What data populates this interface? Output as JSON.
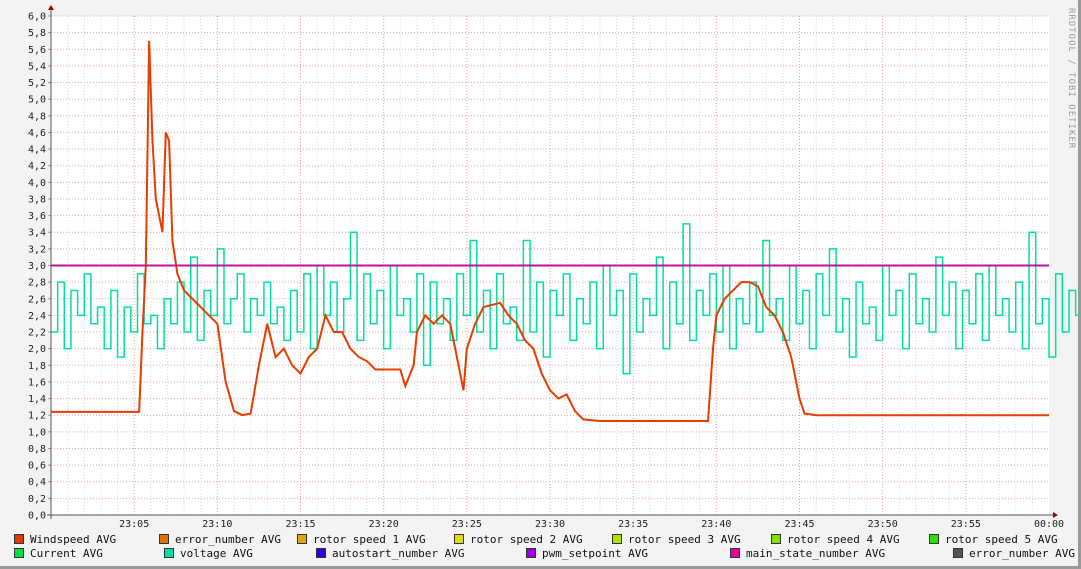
{
  "chart_data": {
    "type": "line",
    "watermark": "RRDTOOL / TOBI OETIKER",
    "ylim": [
      0,
      6
    ],
    "yticks": [
      "0,0",
      "0,2",
      "0,4",
      "0,6",
      "0,8",
      "1,0",
      "1,2",
      "1,4",
      "1,6",
      "1,8",
      "2,0",
      "2,2",
      "2,4",
      "2,6",
      "2,8",
      "3,0",
      "3,2",
      "3,4",
      "3,6",
      "3,8",
      "4,0",
      "4,2",
      "4,4",
      "4,6",
      "4,8",
      "5,0",
      "5,2",
      "5,4",
      "5,6",
      "5,8",
      "6,0"
    ],
    "xlim_minutes": [
      0,
      60
    ],
    "xticks": [
      {
        "m": 5,
        "label": "23:05"
      },
      {
        "m": 10,
        "label": "23:10"
      },
      {
        "m": 15,
        "label": "23:15"
      },
      {
        "m": 20,
        "label": "23:20"
      },
      {
        "m": 25,
        "label": "23:25"
      },
      {
        "m": 30,
        "label": "23:30"
      },
      {
        "m": 35,
        "label": "23:35"
      },
      {
        "m": 40,
        "label": "23:40"
      },
      {
        "m": 45,
        "label": "23:45"
      },
      {
        "m": 50,
        "label": "23:50"
      },
      {
        "m": 55,
        "label": "23:55"
      },
      {
        "m": 60,
        "label": "00:00"
      }
    ],
    "series": [
      {
        "name": "voltage AVG",
        "color": "#00e0a0",
        "step_minutes": 0.4,
        "values": [
          2.2,
          2.8,
          2.0,
          2.7,
          2.4,
          2.9,
          2.3,
          2.5,
          2.0,
          2.7,
          1.9,
          2.5,
          2.2,
          2.9,
          2.3,
          2.4,
          2.0,
          2.6,
          2.3,
          2.8,
          2.2,
          3.1,
          2.1,
          2.7,
          2.4,
          3.2,
          2.3,
          2.6,
          2.9,
          2.2,
          2.6,
          2.4,
          2.8,
          2.3,
          2.5,
          2.1,
          2.7,
          2.2,
          2.9,
          2.0,
          3.0,
          2.4,
          2.8,
          2.2,
          2.6,
          3.4,
          2.1,
          2.9,
          2.3,
          2.7,
          2.0,
          3.0,
          2.4,
          2.6,
          2.2,
          2.9,
          1.8,
          2.8,
          2.3,
          2.6,
          2.1,
          2.9,
          2.4,
          3.3,
          2.2,
          2.7,
          2.0,
          2.9,
          2.3,
          2.5,
          2.1,
          3.3,
          2.2,
          2.8,
          1.9,
          2.7,
          2.4,
          2.9,
          2.1,
          2.6,
          2.3,
          2.8,
          2.0,
          3.0,
          2.4,
          2.7,
          1.7,
          2.9,
          2.2,
          2.6,
          2.4,
          3.1,
          2.0,
          2.8,
          2.3,
          3.5,
          2.1,
          2.7,
          2.4,
          2.9,
          2.2,
          3.0,
          2.0,
          2.6,
          2.3,
          2.8,
          2.2,
          3.3,
          2.4,
          2.6,
          2.1,
          3.0,
          2.3,
          2.7,
          2.0,
          2.9,
          2.4,
          3.2,
          2.2,
          2.6,
          1.9,
          2.8,
          2.3,
          2.5,
          2.1,
          3.0,
          2.4,
          2.7,
          2.0,
          2.9,
          2.3,
          2.6,
          2.2,
          3.1,
          2.4,
          2.8,
          2.0,
          2.7,
          2.3,
          2.9,
          2.1,
          3.0,
          2.4,
          2.6,
          2.2,
          2.8,
          2.0,
          3.4,
          2.3,
          2.6,
          1.9,
          2.9,
          2.2,
          2.7,
          2.4,
          3.0,
          2.1
        ]
      },
      {
        "name": "Windspeed AVG",
        "color": "#e83c00",
        "points": [
          [
            0,
            1.24
          ],
          [
            5.3,
            1.24
          ],
          [
            5.5,
            2.2
          ],
          [
            5.7,
            3.0
          ],
          [
            5.9,
            5.7
          ],
          [
            6.1,
            4.5
          ],
          [
            6.3,
            3.8
          ],
          [
            6.7,
            3.4
          ],
          [
            6.9,
            4.6
          ],
          [
            7.1,
            4.5
          ],
          [
            7.3,
            3.3
          ],
          [
            7.6,
            2.9
          ],
          [
            8,
            2.7
          ],
          [
            8.5,
            2.6
          ],
          [
            9,
            2.5
          ],
          [
            9.5,
            2.4
          ],
          [
            10,
            2.3
          ],
          [
            10.5,
            1.6
          ],
          [
            11,
            1.25
          ],
          [
            11.5,
            1.2
          ],
          [
            12,
            1.22
          ],
          [
            12.5,
            1.8
          ],
          [
            13,
            2.3
          ],
          [
            13.5,
            1.9
          ],
          [
            14,
            2.0
          ],
          [
            14.5,
            1.8
          ],
          [
            15,
            1.7
          ],
          [
            15.5,
            1.9
          ],
          [
            16,
            2.0
          ],
          [
            16.5,
            2.4
          ],
          [
            17,
            2.2
          ],
          [
            17.5,
            2.2
          ],
          [
            18,
            2.0
          ],
          [
            18.5,
            1.9
          ],
          [
            19,
            1.85
          ],
          [
            19.5,
            1.75
          ],
          [
            20,
            1.75
          ],
          [
            21,
            1.75
          ],
          [
            21.3,
            1.55
          ],
          [
            21.8,
            1.8
          ],
          [
            22,
            2.2
          ],
          [
            22.5,
            2.4
          ],
          [
            23,
            2.3
          ],
          [
            23.5,
            2.4
          ],
          [
            24,
            2.3
          ],
          [
            24.5,
            1.8
          ],
          [
            24.8,
            1.5
          ],
          [
            25,
            2.0
          ],
          [
            25.5,
            2.3
          ],
          [
            26,
            2.5
          ],
          [
            27,
            2.55
          ],
          [
            27.5,
            2.4
          ],
          [
            28,
            2.3
          ],
          [
            28.5,
            2.1
          ],
          [
            29,
            2.0
          ],
          [
            29.5,
            1.7
          ],
          [
            30,
            1.5
          ],
          [
            30.5,
            1.4
          ],
          [
            31,
            1.45
          ],
          [
            31.5,
            1.25
          ],
          [
            32,
            1.15
          ],
          [
            33,
            1.13
          ],
          [
            39.5,
            1.13
          ],
          [
            39.8,
            2.0
          ],
          [
            40,
            2.4
          ],
          [
            40.5,
            2.6
          ],
          [
            41,
            2.7
          ],
          [
            41.5,
            2.8
          ],
          [
            42,
            2.8
          ],
          [
            42.5,
            2.75
          ],
          [
            43,
            2.5
          ],
          [
            43.5,
            2.4
          ],
          [
            44,
            2.2
          ],
          [
            44.5,
            1.9
          ],
          [
            45,
            1.4
          ],
          [
            45.3,
            1.22
          ],
          [
            46,
            1.2
          ],
          [
            60,
            1.2
          ]
        ]
      },
      {
        "name": "main_state_number AVG",
        "color": "#c0109f",
        "points": [
          [
            0,
            3.0
          ],
          [
            60,
            3.0
          ]
        ]
      }
    ],
    "legend": [
      [
        {
          "label": "Windspeed AVG",
          "color": "#e03c00"
        },
        {
          "label": "error_number AVG",
          "color": "#e07000"
        },
        {
          "label": "rotor speed 1 AVG",
          "color": "#e0a800"
        },
        {
          "label": "rotor speed 2 AVG",
          "color": "#e0e000"
        },
        {
          "label": "rotor speed 3 AVG",
          "color": "#b0e000"
        },
        {
          "label": "rotor speed 4 AVG",
          "color": "#80e000"
        },
        {
          "label": "rotor speed 5 AVG",
          "color": "#30e000"
        }
      ],
      [
        {
          "label": "Current AVG",
          "color": "#00e040"
        },
        {
          "label": "voltage AVG",
          "color": "#00e0a0"
        },
        {
          "label": "autostart_number AVG",
          "color": "#3000e0"
        },
        {
          "label": "pwm_setpoint AVG",
          "color": "#a000e0"
        },
        {
          "label": "main_state_number AVG",
          "color": "#e000a0"
        },
        {
          "label": "error_number AVG",
          "color": "#555555"
        }
      ]
    ]
  }
}
